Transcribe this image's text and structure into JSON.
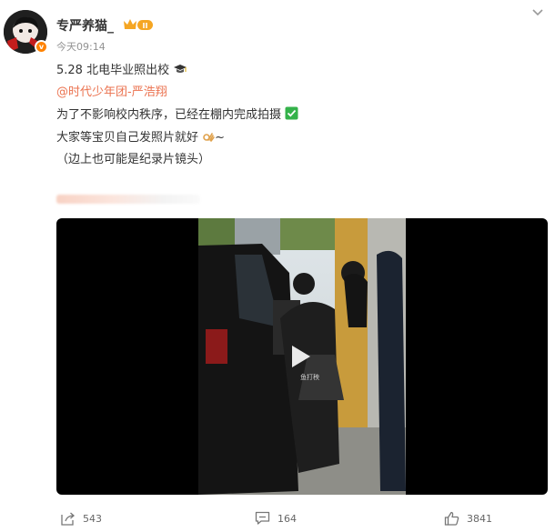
{
  "user": {
    "name": "专严养猫_",
    "vip_level": "II",
    "verified_mark": "v"
  },
  "post": {
    "time": "今天09:14",
    "lines": [
      "5.28 北电毕业照出校",
      "@时代少年团-严浩翔",
      "为了不影响校内秩序，已经在棚内完成拍摄",
      "大家等宝贝自己发照片就好",
      "（边上也可能是纪录片镜头）"
    ],
    "line_end_marks": {
      "line1": "~"
    },
    "icons": {
      "line0": "graduation-cap-icon",
      "line2": "check-mark-icon",
      "line3": "ok-hand-icon"
    },
    "mention_color": "#eb7350"
  },
  "video": {
    "watermark": "鱼打秧",
    "has_play_button": true
  },
  "actions": {
    "share_count": "543",
    "comment_count": "164",
    "like_count": "3841"
  },
  "colors": {
    "accent_orange": "#ff8200",
    "text_main": "#333333",
    "text_meta": "#939393",
    "vip_gold": "#f5a623"
  }
}
